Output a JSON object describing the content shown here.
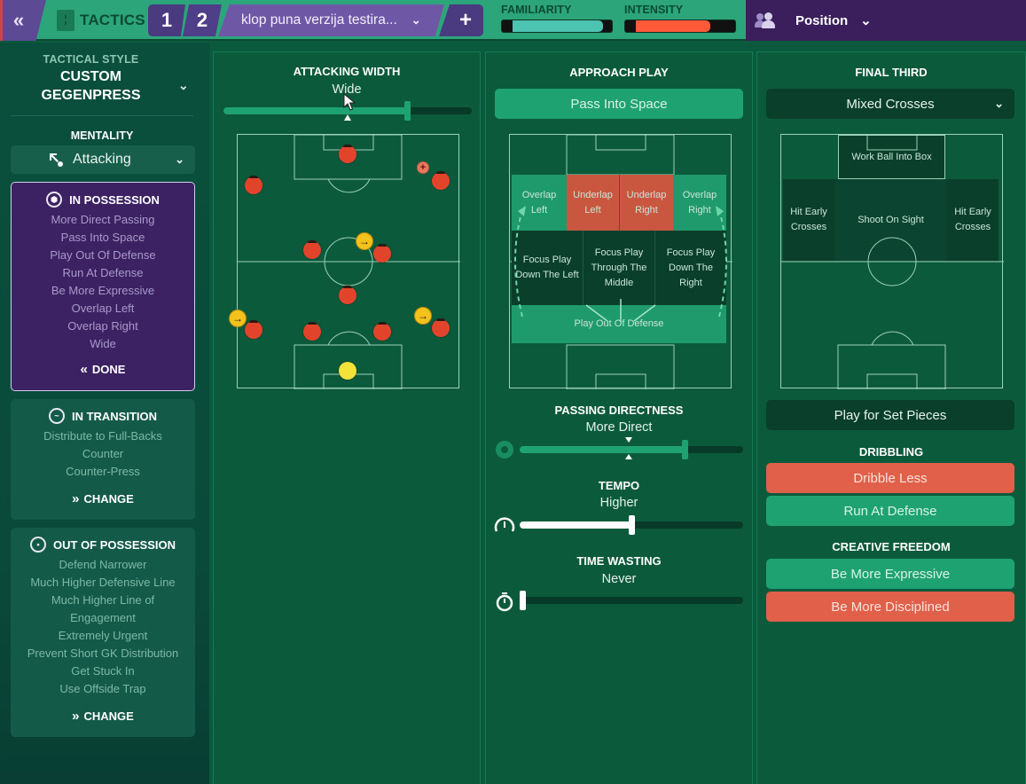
{
  "topbar": {
    "back_icon": "double-chevron-left-icon",
    "back_glyph": "«",
    "section": "TACTICS",
    "slot1": "1",
    "slot2": "2",
    "tactic_name": "klop puna verzija testira...",
    "dropdown_glyph": "⌄",
    "add_glyph": "+",
    "familiarity": {
      "label": "FAMILIARITY",
      "value_pct": 92,
      "color": "#4cc3b0"
    },
    "intensity": {
      "label": "INTENSITY",
      "value_pct": 76,
      "color": "#fe5a3a"
    },
    "position_label": "Position",
    "position_chev": "⌄"
  },
  "sidebar": {
    "style_sub": "TACTICAL STYLE",
    "style_name_line1": "CUSTOM",
    "style_name_line2": "GEGENPRESS",
    "style_chev": "⌄",
    "mentality_label": "MENTALITY",
    "mentality_value": "Attacking",
    "mentality_chev": "⌄",
    "in_possession": {
      "title": "IN POSSESSION",
      "items": [
        "More Direct Passing",
        "Pass Into Space",
        "Play Out Of Defense",
        "Run At Defense",
        "Be More Expressive",
        "Overlap Left",
        "Overlap Right",
        "Wide"
      ],
      "action": "DONE",
      "action_glyph": "«"
    },
    "in_transition": {
      "title": "IN TRANSITION",
      "items": [
        "Distribute to Full-Backs",
        "Counter",
        "Counter-Press"
      ],
      "action": "CHANGE",
      "action_glyph": "»"
    },
    "out_of_possession": {
      "title": "OUT OF POSSESSION",
      "items": [
        "Defend Narrower",
        "Much Higher Defensive Line",
        "Much Higher Line of",
        "Engagement",
        "Extremely Urgent",
        "Prevent Short GK Distribution",
        "Get Stuck In",
        "Use Offside Trap"
      ],
      "action": "CHANGE",
      "action_glyph": "»"
    }
  },
  "attacking_width": {
    "title": "ATTACKING WIDTH",
    "value": "Wide",
    "level": 0.74,
    "marker": 0.5
  },
  "approach_play": {
    "title": "APPROACH PLAY",
    "selected": "Pass Into Space",
    "zones": {
      "overlap_left": [
        "Overlap",
        "Left"
      ],
      "underlap_left": [
        "Underlap",
        "Left"
      ],
      "underlap_right": [
        "Underlap",
        "Right"
      ],
      "overlap_right": [
        "Overlap",
        "Right"
      ],
      "focus_left": [
        "Focus Play",
        "Down The Left"
      ],
      "focus_middle": [
        "Focus Play",
        "Through The",
        "Middle"
      ],
      "focus_right": [
        "Focus Play",
        "Down The",
        "Right"
      ],
      "play_out": "Play Out Of Defense"
    },
    "passing_directness": {
      "title": "PASSING DIRECTNESS",
      "value": "More Direct",
      "level": 0.74,
      "marker": 0.49
    },
    "tempo": {
      "title": "TEMPO",
      "value": "Higher",
      "level": 0.5
    },
    "time_wasting": {
      "title": "TIME WASTING",
      "value": "Never",
      "level": 0.0
    }
  },
  "final_third": {
    "title": "FINAL THIRD",
    "selected": "Mixed Crosses",
    "chev": "⌄",
    "zones": {
      "work_ball": "Work Ball Into Box",
      "hit_early_left": [
        "Hit Early",
        "Crosses"
      ],
      "shoot": "Shoot On Sight",
      "hit_early_right": [
        "Hit Early",
        "Crosses"
      ]
    },
    "set_pieces": "Play for Set Pieces",
    "dribbling_title": "DRIBBLING",
    "dribble_less": "Dribble Less",
    "run_at_defense": "Run At Defense",
    "creative_title": "CREATIVE FREEDOM",
    "be_more_expressive": "Be More Expressive",
    "be_more_disciplined": "Be More Disciplined"
  },
  "colors": {
    "accent_green": "#1fa271",
    "selected_red": "#e0604a",
    "purple": "#3c2263"
  }
}
